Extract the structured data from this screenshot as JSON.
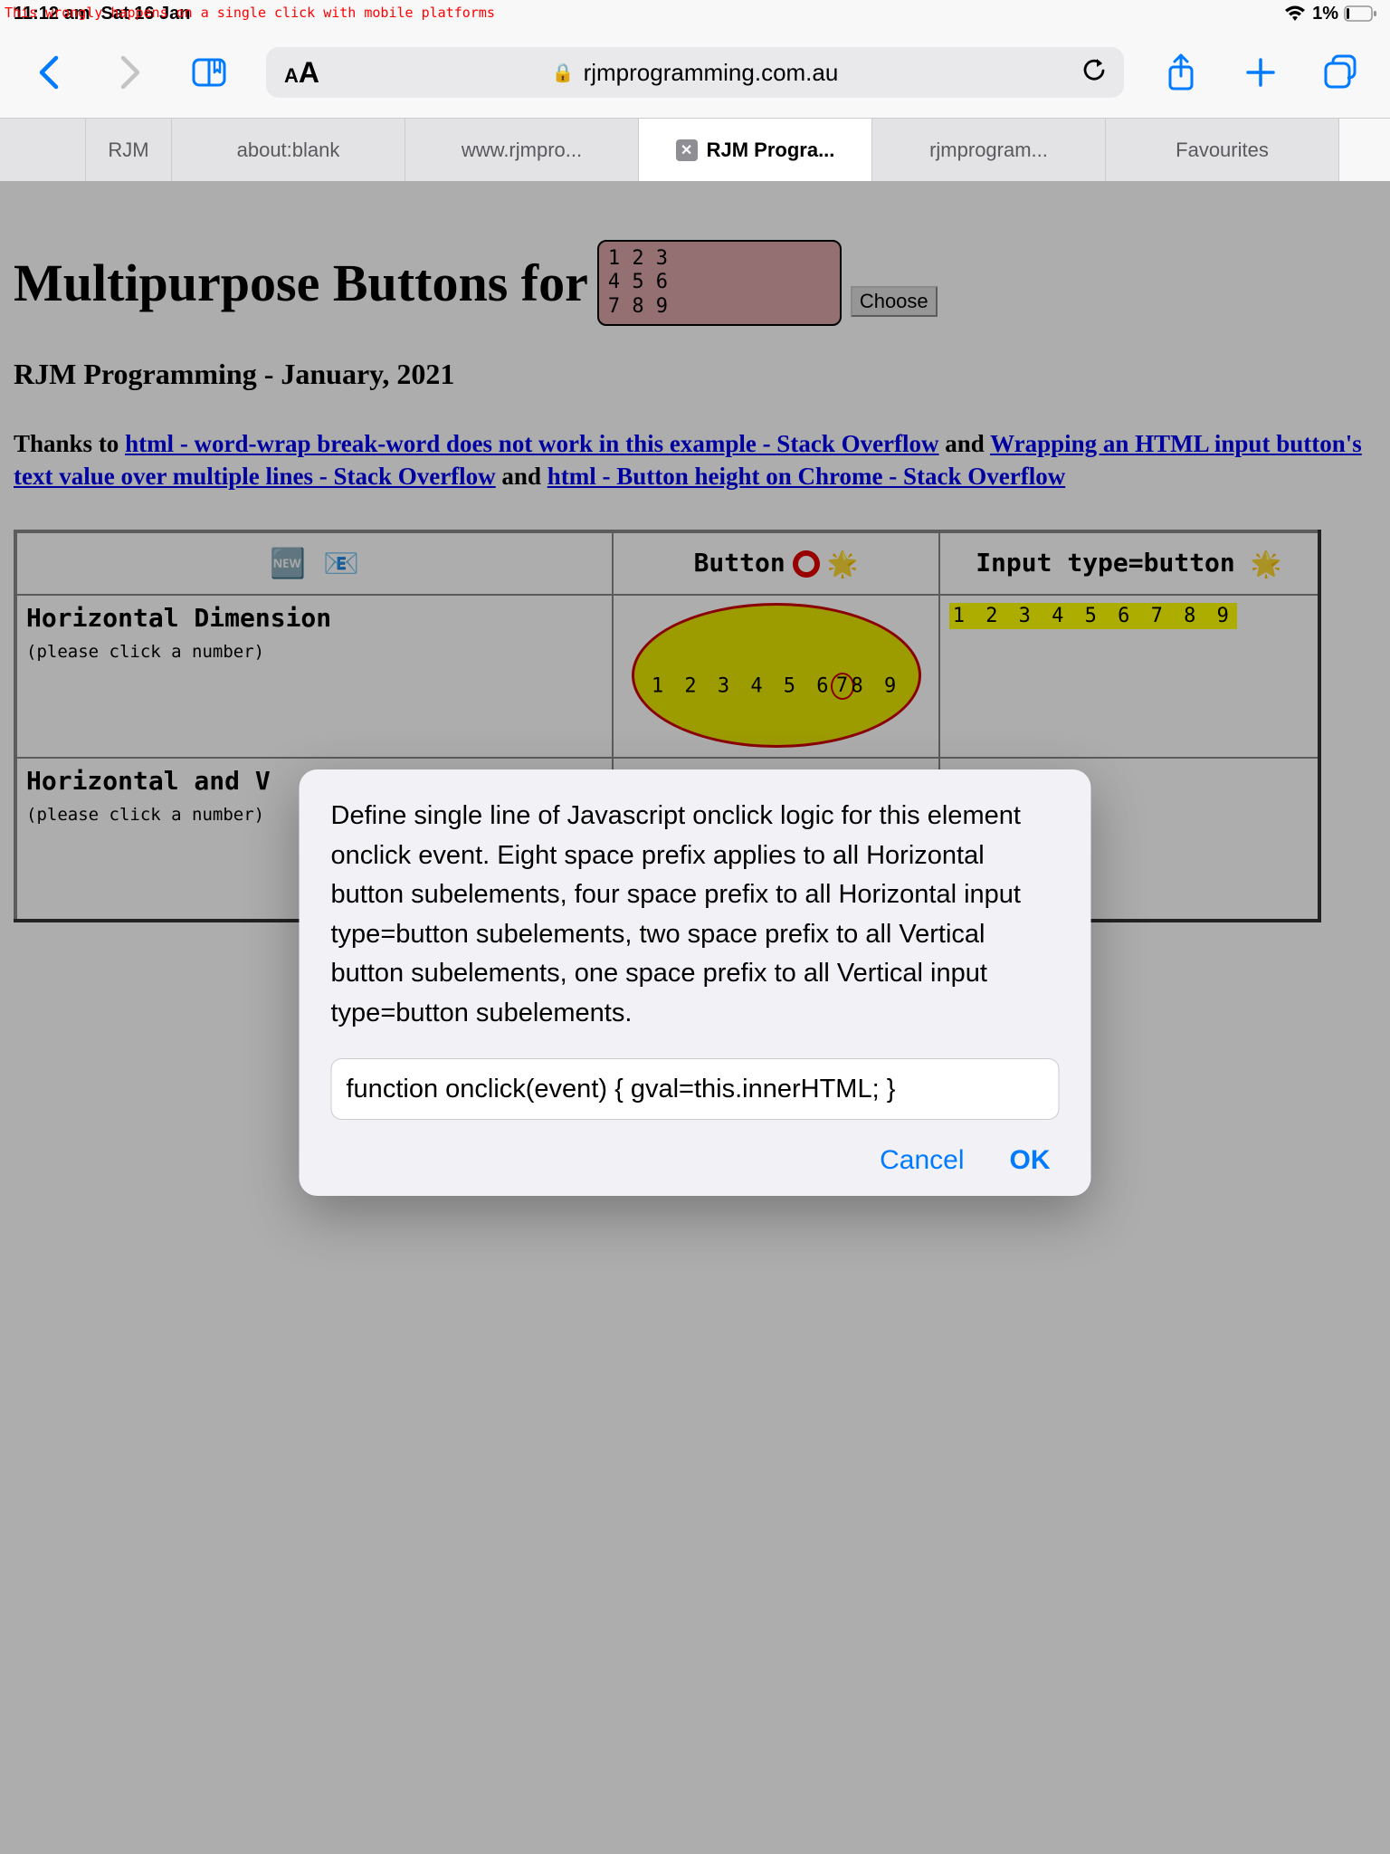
{
  "annotation": "This wrongly happens on a single click with mobile platforms",
  "status": {
    "time": "11:12 am",
    "date": "Sat 16 Jan",
    "battery": "1%"
  },
  "url": {
    "domain": "rjmprogramming.com.au"
  },
  "tabs": {
    "t0": "RJM",
    "t1": "about:blank",
    "t2": "www.rjmpro...",
    "t3": "RJM Progra...",
    "t4": "rjmprogram...",
    "t5": "Favourites"
  },
  "page": {
    "h1": "Multipurpose Buttons for",
    "dropdown_lines": "1 2 3\n4 5 6\n7 8 9",
    "choose": "Choose",
    "h3": "RJM Programming - January, 2021",
    "thanks_pre": "Thanks to ",
    "link1": "html - word-wrap break-word does not work in this example - Stack Overflow",
    "thanks_and1": " and ",
    "link2": "Wrapping an HTML input button's text value over multiple lines - Stack Overflow",
    "thanks_and2": " and ",
    "link3": "html - Button height on Chrome - Stack Overflow",
    "thead": {
      "c1": "🆕  📧",
      "c2": "Button",
      "c3": "Input type=button"
    },
    "row1": {
      "label": "Horizontal Dimension",
      "hint": "(please click a number)",
      "nums_a": "1 2 3 4 5 6",
      "seven": "7",
      "nums_b": "8 9",
      "hl": "1 2 3 4 5 6 7 8 9"
    },
    "row2": {
      "label": "Horizontal and V",
      "hint": "(please click a number)"
    }
  },
  "dialog": {
    "message": "Define single line of Javascript onclick logic for this element onclick event.  Eight space prefix applies to all Horizontal button subelements, four space prefix to all Horizontal input type=button subelements, two space prefix to all Vertical button subelements, one space prefix to all Vertical input type=button subelements.",
    "input_value": "function onclick(event) { gval=this.innerHTML; }",
    "cancel": "Cancel",
    "ok": "OK"
  }
}
